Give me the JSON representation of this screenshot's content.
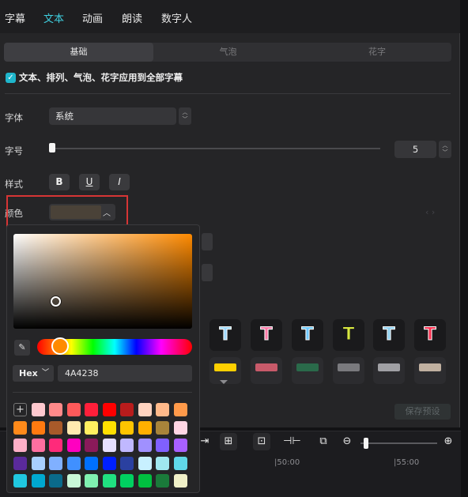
{
  "topnav": {
    "tabs": [
      "字幕",
      "文本",
      "动画",
      "朗读",
      "数字人"
    ],
    "active_index": 1
  },
  "subtabs": {
    "items": [
      "基础",
      "气泡",
      "花字"
    ],
    "active_index": 0
  },
  "apply_all": {
    "checked": true,
    "label": "文本、排列、气泡、花字应用到全部字幕"
  },
  "font": {
    "label": "字体",
    "value": "系统"
  },
  "size": {
    "label": "字号",
    "value": "5"
  },
  "style": {
    "label": "样式",
    "bold": "B",
    "underline": "U",
    "italic": "I"
  },
  "color": {
    "label": "颜色",
    "value": "#4A4238"
  },
  "picker": {
    "format": "Hex",
    "hex_value": "4A4238",
    "hue_color": "#ff8a00",
    "swatches": [
      [
        "#ffffff",
        "#ffc9cf",
        "#ff8a8a",
        "#ff5a5a",
        "#ff1f3a",
        "#ff0000",
        "#b81c1c",
        "#ffd3c0",
        "#ffb98a",
        "#ff9a4a"
      ],
      [
        "#ff8a1a",
        "#ff7a10",
        "#a85a2a",
        "#ffeab0",
        "#ffef60",
        "#ffe000",
        "#ffc400",
        "#ffb000",
        "#a8843a",
        "#ffd6e4"
      ],
      [
        "#ffb0c8",
        "#ff6fa0",
        "#ff2a7a",
        "#ff00c0",
        "#8a1a5a",
        "#e6e0ff",
        "#c0b8ff",
        "#a090ff",
        "#8060ff",
        "#a860ff"
      ],
      [
        "#5a2a9a",
        "#a8d0ff",
        "#80b0ff",
        "#4090ff",
        "#0070ff",
        "#0020ff",
        "#2a40a0",
        "#c8f0ff",
        "#a0e8f0",
        "#60d8e8"
      ],
      [
        "#20c8e0",
        "#00a8d0",
        "#0a6a8a",
        "#c8f8d8",
        "#80f0b0",
        "#20e080",
        "#00d060",
        "#00c040",
        "#1a7a3a",
        "#f0f0c8"
      ]
    ]
  },
  "presets": {
    "row1_letter": "T",
    "row1_colors": [
      "#9fd8ff",
      "#ff7aa8",
      "#6ec8ff",
      "#d8e840",
      "#8fd0f0",
      "#ff3050"
    ],
    "row2_colors": [
      "#ffd000",
      "#c85a6a",
      "#2a6a4a",
      "#7a7a7e",
      "#a0a0a4",
      "#c0b0a0"
    ]
  },
  "save_preset": "保存预设",
  "timeline": {
    "marks": [
      "|50:00",
      "|55:00"
    ]
  }
}
